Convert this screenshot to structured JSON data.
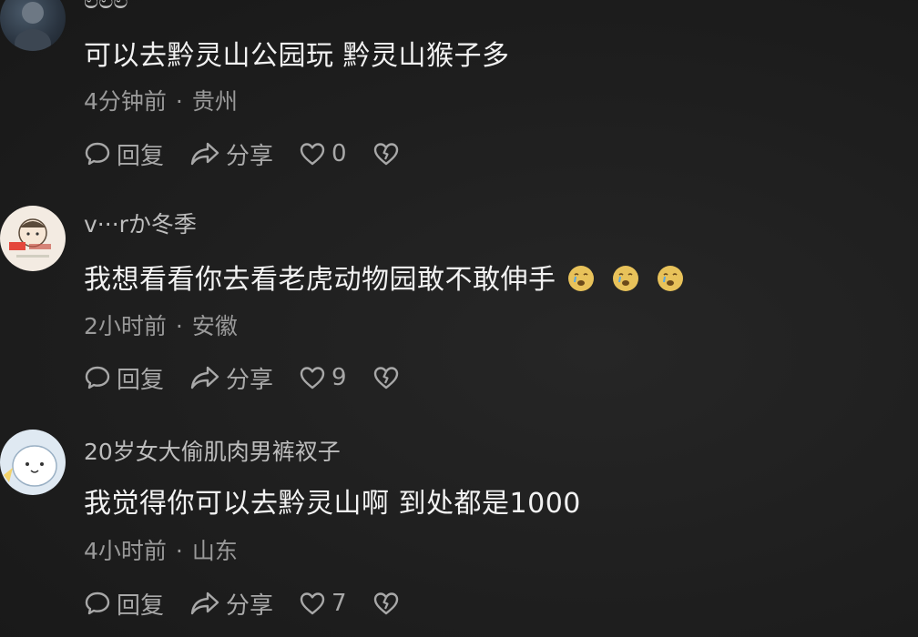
{
  "comments": [
    {
      "username": "ಲಲಲ",
      "text": "可以去黔灵山公园玩 黔灵山猴子多",
      "time": "4分钟前",
      "location": "贵州",
      "reply_label": "回复",
      "share_label": "分享",
      "likes": "0"
    },
    {
      "username": "v···rか冬季",
      "text": "我想看看你去看老虎动物园敢不敢伸手",
      "emojis": [
        "crying-face-emoji",
        "crying-face-emoji",
        "crying-face-emoji"
      ],
      "time": "2小时前",
      "location": "安徽",
      "reply_label": "回复",
      "share_label": "分享",
      "likes": "9"
    },
    {
      "username": "20岁女大偷肌肉男裤衩子",
      "text": "我觉得你可以去黔灵山啊 到处都是1000",
      "time": "4小时前",
      "location": "山东",
      "reply_label": "回复",
      "share_label": "分享",
      "likes": "7"
    }
  ],
  "meta_separator": "·",
  "colors": {
    "background": "#1f1f1f",
    "text": "#f2f2f2",
    "meta": "#9a9a9a",
    "emoji": "#e8c25a"
  }
}
